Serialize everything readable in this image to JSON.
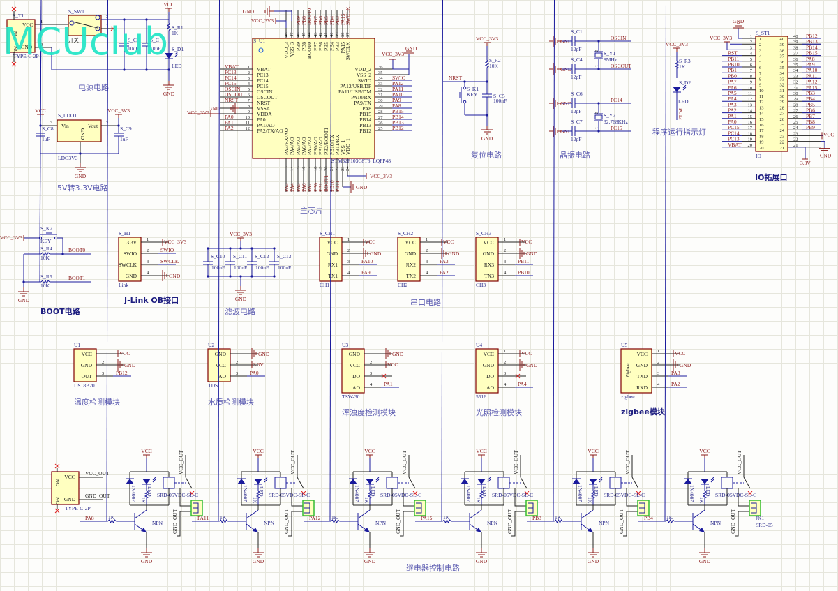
{
  "logo": "MCUclub",
  "colors": {
    "wire": "#1a1a9c",
    "net_label": "#8b1a1a",
    "body_fill": "#ffffc0",
    "body_border": "#800000",
    "title": "#5a5ab0",
    "logo": "#22e6c6",
    "terminal": "#33bb33"
  },
  "titles": {
    "power": "电源电路",
    "ldo": "5V转3.3V电路",
    "chip": "主芯片",
    "reset": "复位电路",
    "crystal": "晶振电路",
    "indicator": "程序运行指示灯",
    "io": "IO拓展口",
    "boot": "BOOT电路",
    "jlink": "J-Link OB接口",
    "filter": "滤波电路",
    "uart": "串口电路",
    "temp": "温度检测模块",
    "water": "水质检测模块",
    "turbidity": "浑浊度检测模块",
    "light": "光照检测模块",
    "zigbee": "zigbee模块",
    "relay": "继电器控制电路"
  },
  "common": {
    "vcc": "VCC",
    "gnd": "GND",
    "vcc3v3": "VCC_3V3",
    "v33": "3.3V"
  },
  "power": {
    "t1_ref": "S_T1",
    "t1_vcc": "VCC",
    "t1_gnd": "GND",
    "t1_footer": "TYPE-C-2P",
    "nc": "NC",
    "p1": "1",
    "p2": "2",
    "p3": "3",
    "sw_ref": "S_SW1",
    "sw_name": "开关",
    "r1_ref": "S_R1",
    "r1_val": "1K",
    "d1_ref": "S_D1",
    "d1_val": "LED",
    "c_val": "10uF",
    "c_ref": "S_C"
  },
  "ldo": {
    "ref": "S_LDO1",
    "vin": "Vin",
    "vout": "Vout",
    "gnd": "GND",
    "footer": "LDO3V3",
    "c8": "S_C8",
    "c9": "S_C9",
    "c_val": "1uF",
    "p1": "1",
    "p2": "2",
    "p3": "3"
  },
  "chip": {
    "ref": "S_U1",
    "part": "STM32F103C8T6_LQFP48",
    "left": [
      {
        "num": "1",
        "name": "VBAT",
        "net": "VBAT"
      },
      {
        "num": "2",
        "name": "PC13",
        "net": "PC13"
      },
      {
        "num": "3",
        "name": "PC14",
        "net": "PC14"
      },
      {
        "num": "4",
        "name": "PC15",
        "net": "PC15"
      },
      {
        "num": "5",
        "name": "OSCIN",
        "net": "OSCIN"
      },
      {
        "num": "6",
        "name": "OSCOUT",
        "net": "OSCOUT"
      },
      {
        "num": "7",
        "name": "NRST",
        "net": "NRST"
      },
      {
        "num": "8",
        "name": "VSSA",
        "net": "GND"
      },
      {
        "num": "9",
        "name": "VDDA",
        "net": "VCC_3V3"
      },
      {
        "num": "10",
        "name": "PA0",
        "net": "PA0"
      },
      {
        "num": "11",
        "name": "PA1/AO",
        "net": "PA1"
      },
      {
        "num": "12",
        "name": "PA2/TX/AO",
        "net": "PA2"
      }
    ],
    "right": [
      {
        "num": "36",
        "name": "VDD_2",
        "net": "VCC_3V3"
      },
      {
        "num": "35",
        "name": "VSS_2",
        "net": "GND"
      },
      {
        "num": "34",
        "name": "SWIO",
        "net": "SWIO"
      },
      {
        "num": "33",
        "name": "PA12/USB/DP",
        "net": "PA12"
      },
      {
        "num": "32",
        "name": "PA11/USB/DM",
        "net": "PA11"
      },
      {
        "num": "31",
        "name": "PA10/RX",
        "net": "PA10"
      },
      {
        "num": "30",
        "name": "PA9/TX",
        "net": "PA9"
      },
      {
        "num": "29",
        "name": "PA8",
        "net": "PA8"
      },
      {
        "num": "28",
        "name": "PB15",
        "net": "PB15"
      },
      {
        "num": "27",
        "name": "PB14",
        "net": "PB14"
      },
      {
        "num": "26",
        "name": "PB13",
        "net": "PB13"
      },
      {
        "num": "25",
        "name": "PB12",
        "net": "PB12"
      }
    ],
    "top": [
      {
        "num": "48",
        "name": "VDD_3",
        "net": "VCC_3V3"
      },
      {
        "num": "47",
        "name": "VSS_3",
        "net": "GND"
      },
      {
        "num": "46",
        "name": "PB9",
        "net": "PB9"
      },
      {
        "num": "45",
        "name": "PB8",
        "net": "PB8"
      },
      {
        "num": "44",
        "name": "BOOT0",
        "net": "BOOT0"
      },
      {
        "num": "43",
        "name": "PB7",
        "net": "PB7"
      },
      {
        "num": "42",
        "name": "PB6",
        "net": "PB6"
      },
      {
        "num": "41",
        "name": "PB5",
        "net": "PB5"
      },
      {
        "num": "40",
        "name": "PB4",
        "net": "PB4"
      },
      {
        "num": "39",
        "name": "PB3",
        "net": "PB3"
      },
      {
        "num": "38",
        "name": "PA15",
        "net": "PA15"
      },
      {
        "num": "37",
        "name": "SWCLK",
        "net": "SWCLK"
      }
    ],
    "bottom": [
      {
        "num": "13",
        "name": "PA3/RX/AO",
        "net": "PA3"
      },
      {
        "num": "14",
        "name": "PA4/AO",
        "net": "PA4"
      },
      {
        "num": "15",
        "name": "PA5/AO",
        "net": "PA5"
      },
      {
        "num": "16",
        "name": "PA6/AO",
        "net": "PA6"
      },
      {
        "num": "17",
        "name": "PA7/AO",
        "net": "PA7"
      },
      {
        "num": "18",
        "name": "PB0/AO",
        "net": "PB0"
      },
      {
        "num": "19",
        "name": "PB1/AO",
        "net": "PB1"
      },
      {
        "num": "20",
        "name": "PB2/BOOT1",
        "net": "BOOT1"
      },
      {
        "num": "21",
        "name": "PB10/TX",
        "net": "PB10"
      },
      {
        "num": "22",
        "name": "PB11/RX",
        "net": "PB11"
      },
      {
        "num": "23",
        "name": "VSS_1",
        "net": "GND"
      },
      {
        "num": "24",
        "name": "VDD_1",
        "net": "VCC_3V3"
      }
    ]
  },
  "reset": {
    "nrst": "NRST",
    "r2_ref": "S_R2",
    "r2_val": "10K",
    "k1_ref": "S_K1",
    "k1_val": "KEY",
    "c5_ref": "S_C5",
    "c5_val": "100nF"
  },
  "crystal": {
    "caps": [
      {
        "ref": "S_C1",
        "val": "12pF"
      },
      {
        "ref": "S_C4",
        "val": "12pF"
      },
      {
        "ref": "S_C6",
        "val": "12pF"
      },
      {
        "ref": "S_C7",
        "val": "12pF"
      }
    ],
    "nets": [
      "OSCIN",
      "OSCOUT",
      "PC14",
      "PC15"
    ],
    "y1_ref": "S_Y1",
    "y1_val": "8MHz",
    "y2_ref": "S_Y2",
    "y2_val": "32.768KHz",
    "p1": "1",
    "p2": "2"
  },
  "indicator": {
    "r3_ref": "S_R3",
    "r3_val": "1K",
    "d2_ref": "S_D2",
    "d2_val": "LED",
    "net": "PC13"
  },
  "io": {
    "ref": "S_ST1",
    "footer": "IO",
    "left": [
      "GND",
      "VCC_3V3",
      "",
      "RST",
      "PB11",
      "PB10",
      "PB1",
      "PB0",
      "PA7",
      "PA6",
      "PA5",
      "PA4",
      "PA3",
      "PA2",
      "PA1",
      "PA0",
      "PC15",
      "PC14",
      "PC13",
      "VBAT"
    ],
    "right": [
      "PB12",
      "PB13",
      "PB14",
      "PB15",
      "PA8",
      "PA9",
      "PA10",
      "PA11",
      "PA12",
      "PA15",
      "PB3",
      "PB4",
      "PB5",
      "PB6",
      "PB7",
      "PB8",
      "PB9",
      "VCC",
      "GND",
      "3.3V"
    ],
    "left_nums": [
      "1",
      "2",
      "3",
      "4",
      "5",
      "6",
      "7",
      "8",
      "9",
      "10",
      "11",
      "12",
      "13",
      "14",
      "15",
      "16",
      "17",
      "18",
      "19",
      "20"
    ],
    "right_nums": [
      "40",
      "39",
      "38",
      "37",
      "36",
      "35",
      "34",
      "33",
      "32",
      "31",
      "30",
      "29",
      "28",
      "27",
      "26",
      "25",
      "24",
      "23",
      "22",
      "21"
    ]
  },
  "boot": {
    "k2_ref": "S_K2",
    "k2_val": "KEY",
    "r4_ref": "S_R4",
    "r5_ref": "S_R5",
    "r_val": "10K",
    "boot0": "BOOT0",
    "boot1": "BOOT1"
  },
  "filter": {
    "caps": [
      {
        "ref": "S_C10",
        "val": "100nF"
      },
      {
        "ref": "S_C11",
        "val": "100nF"
      },
      {
        "ref": "S_C12",
        "val": "100nF"
      },
      {
        "ref": "S_C13",
        "val": "100nF"
      }
    ]
  },
  "modules": {
    "h1": {
      "ref": "S_H1",
      "footer": "Link",
      "pins": [
        {
          "num": "1",
          "name": "3.3V",
          "net": "VCC_3V3",
          "type": "vcc"
        },
        {
          "num": "2",
          "name": "SWIO",
          "net": "SWIO",
          "type": "sig"
        },
        {
          "num": "3",
          "name": "SWCLK",
          "net": "SWCLK",
          "type": "sig"
        },
        {
          "num": "4",
          "name": "GND",
          "net": "GND",
          "type": "gnd"
        }
      ]
    },
    "ch1": {
      "ref": "S_CH1",
      "footer": "CH1",
      "pins": [
        {
          "num": "1",
          "name": "VCC",
          "net": "VCC",
          "type": "vcc"
        },
        {
          "num": "2",
          "name": "GND",
          "net": "GND",
          "type": "gnd"
        },
        {
          "num": "3",
          "name": "RX1",
          "net": "PA10",
          "type": "sig"
        },
        {
          "num": "4",
          "name": "TX1",
          "net": "PA9",
          "type": "sig"
        }
      ]
    },
    "ch2": {
      "ref": "S_CH2",
      "footer": "CH2",
      "pins": [
        {
          "num": "1",
          "name": "VCC",
          "net": "VCC",
          "type": "vcc"
        },
        {
          "num": "2",
          "name": "GND",
          "net": "GND",
          "type": "gnd"
        },
        {
          "num": "3",
          "name": "RX2",
          "net": "PA3",
          "type": "sig"
        },
        {
          "num": "4",
          "name": "TX2",
          "net": "PA2",
          "type": "sig"
        }
      ]
    },
    "ch3": {
      "ref": "S_CH3",
      "footer": "CH3",
      "pins": [
        {
          "num": "1",
          "name": "VCC",
          "net": "VCC",
          "type": "vcc"
        },
        {
          "num": "2",
          "name": "GND",
          "net": "GND",
          "type": "gnd"
        },
        {
          "num": "3",
          "name": "RX3",
          "net": "PB11",
          "type": "sig"
        },
        {
          "num": "4",
          "name": "TX3",
          "net": "PB10",
          "type": "sig"
        }
      ]
    },
    "u1": {
      "ref": "U1",
      "footer": "DS18B20",
      "pins": [
        {
          "num": "1",
          "name": "VCC",
          "net": "VCC",
          "type": "vcc"
        },
        {
          "num": "2",
          "name": "GND",
          "net": "GND",
          "type": "gnd"
        },
        {
          "num": "3",
          "name": "OUT",
          "net": "PB12",
          "type": "sig"
        }
      ]
    },
    "u2": {
      "ref": "U2",
      "footer": "TDS",
      "pins": [
        {
          "num": "1",
          "name": "GND",
          "net": "GND",
          "type": "gnd"
        },
        {
          "num": "2",
          "name": "VCC",
          "net": "3.3V",
          "type": "vcc"
        },
        {
          "num": "3",
          "name": "AO",
          "net": "PA0",
          "type": "sig"
        }
      ]
    },
    "u3": {
      "ref": "U3",
      "footer": "TSW-30",
      "pins": [
        {
          "num": "1",
          "name": "GND",
          "net": "GND",
          "type": "gnd"
        },
        {
          "num": "2",
          "name": "VCC",
          "net": "VCC",
          "type": "vcc"
        },
        {
          "num": "3",
          "name": "DO",
          "net": "",
          "type": "nc"
        },
        {
          "num": "4",
          "name": "AO",
          "net": "PA1",
          "type": "sig"
        }
      ]
    },
    "u4": {
      "ref": "U4",
      "footer": "5516",
      "pins": [
        {
          "num": "1",
          "name": "VCC",
          "net": "VCC",
          "type": "vcc"
        },
        {
          "num": "2",
          "name": "GND",
          "net": "GND",
          "type": "gnd"
        },
        {
          "num": "3",
          "name": "DO",
          "net": "",
          "type": "nc"
        },
        {
          "num": "4",
          "name": "AO",
          "net": "PA4",
          "type": "sig"
        }
      ]
    },
    "u5": {
      "ref": "U5",
      "footer": "zigbee",
      "body": "Zigbee",
      "pins": [
        {
          "num": "1",
          "name": "VCC",
          "net": "VCC",
          "type": "vcc"
        },
        {
          "num": "2",
          "name": "GND",
          "net": "GND",
          "type": "gnd"
        },
        {
          "num": "3",
          "name": "TXD",
          "net": "PA3",
          "type": "sig"
        },
        {
          "num": "4",
          "name": "RXD",
          "net": "PA2",
          "type": "sig"
        }
      ]
    }
  },
  "relay": {
    "typec": {
      "vcc": "VCC",
      "gnd": "GND",
      "nc": "NC",
      "footer": "TYPE-C-2P",
      "vcc_out": "VCC_OUT",
      "gnd_out": "GND_OUT"
    },
    "diode": "1N4007",
    "led": "LED",
    "res": "1K",
    "npn": "NPN",
    "relay_part": "SRD-05VDC-SL-C",
    "vcc_out": "VCC_OUT",
    "gnd_out": "GND_OUT",
    "channels": [
      {
        "input": "PA8",
        "out_label": "PA11"
      },
      {
        "input": "",
        "out_label": "PA12"
      },
      {
        "input": "",
        "out_label": "PA15"
      },
      {
        "input": "",
        "out_label": "PB3"
      },
      {
        "input": "",
        "out_label": "PB4"
      },
      {
        "input": "",
        "out_label": "JK1",
        "out_label2": "SRD-05"
      }
    ]
  }
}
